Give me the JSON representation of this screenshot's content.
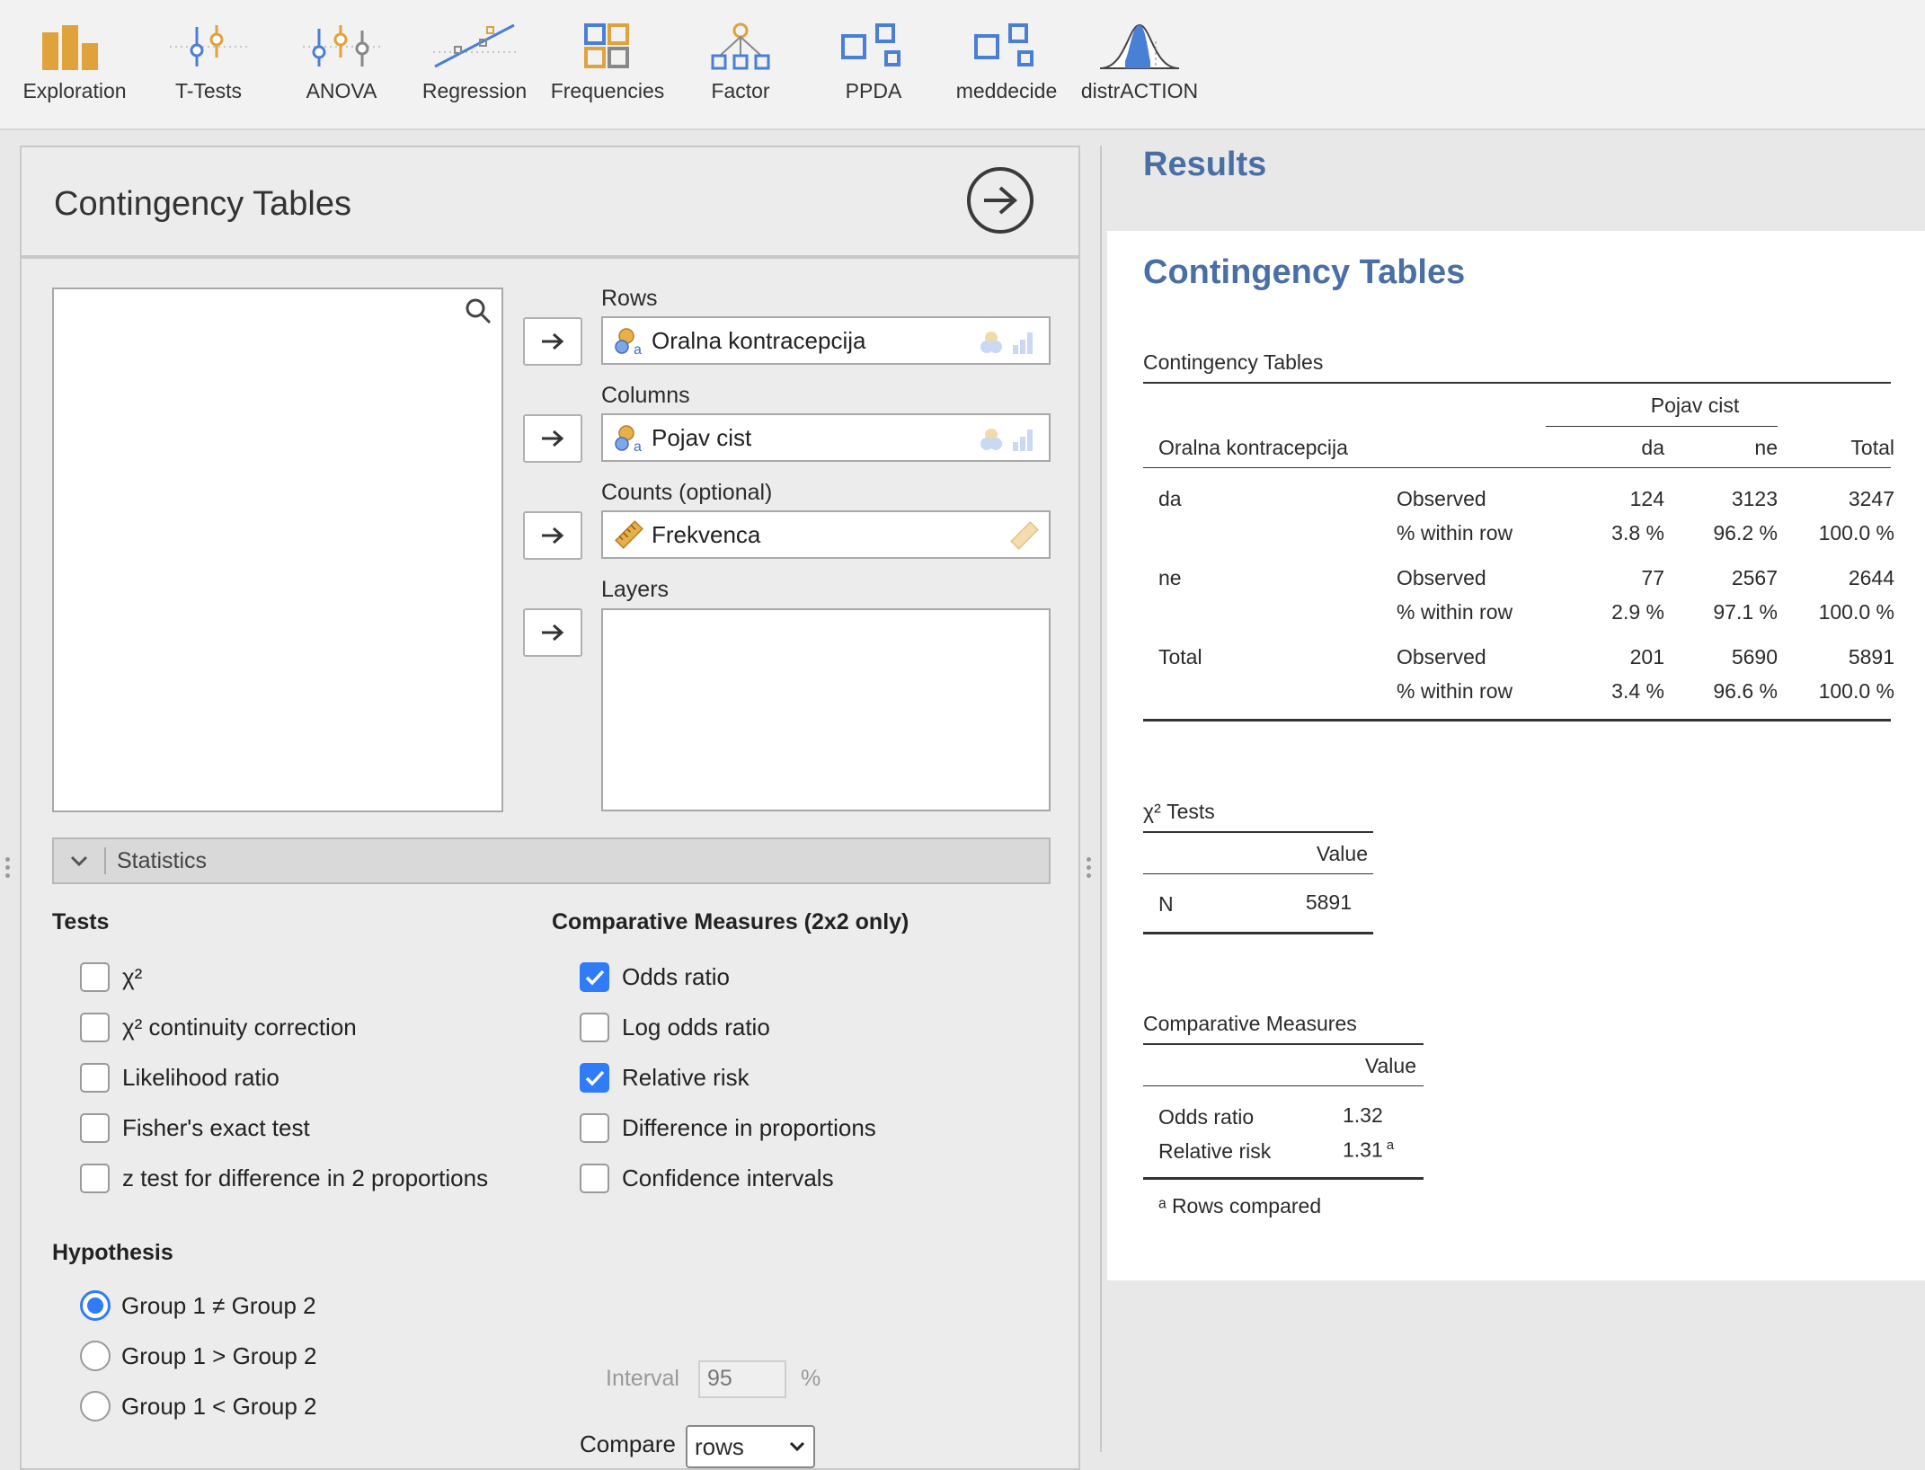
{
  "toolbar": {
    "items": [
      {
        "label": "Exploration",
        "icon": "exploration-icon"
      },
      {
        "label": "T-Tests",
        "icon": "t-tests-icon"
      },
      {
        "label": "ANOVA",
        "icon": "anova-icon"
      },
      {
        "label": "Regression",
        "icon": "regression-icon"
      },
      {
        "label": "Frequencies",
        "icon": "frequencies-icon"
      },
      {
        "label": "Factor",
        "icon": "factor-icon"
      },
      {
        "label": "PPDA",
        "icon": "ppda-icon"
      },
      {
        "label": "meddecide",
        "icon": "meddecide-icon"
      },
      {
        "label": "distrACTION",
        "icon": "distraction-icon"
      }
    ]
  },
  "analysis": {
    "title": "Contingency Tables",
    "rows": {
      "label": "Rows",
      "value": "Oralna kontracepcija"
    },
    "columns": {
      "label": "Columns",
      "value": "Pojav cist"
    },
    "counts": {
      "label": "Counts (optional)",
      "value": "Frekvenca"
    },
    "layers": {
      "label": "Layers"
    }
  },
  "statistics": {
    "section_title": "Statistics",
    "tests_heading": "Tests",
    "tests": [
      {
        "label": "χ²",
        "checked": false
      },
      {
        "label": "χ² continuity correction",
        "checked": false
      },
      {
        "label": "Likelihood ratio",
        "checked": false
      },
      {
        "label": "Fisher's exact test",
        "checked": false
      },
      {
        "label": "z test for difference in 2 proportions",
        "checked": false
      }
    ],
    "comparative_heading": "Comparative Measures (2x2 only)",
    "comparative": [
      {
        "label": "Odds ratio",
        "checked": true
      },
      {
        "label": "Log odds ratio",
        "checked": false
      },
      {
        "label": "Relative risk",
        "checked": true
      },
      {
        "label": "Difference in proportions",
        "checked": false
      },
      {
        "label": "Confidence intervals",
        "checked": false
      }
    ],
    "interval_label": "Interval",
    "interval_value": "95",
    "interval_unit": "%",
    "compare_label": "Compare",
    "compare_value": "rows",
    "hypothesis_heading": "Hypothesis",
    "hypothesis": [
      {
        "label": "Group 1 ≠ Group 2",
        "checked": true
      },
      {
        "label": "Group 1 > Group 2",
        "checked": false
      },
      {
        "label": "Group 1 < Group 2",
        "checked": false
      }
    ]
  },
  "results": {
    "title": "Results",
    "heading": "Contingency Tables",
    "table1": {
      "caption": "Contingency Tables",
      "group_header": "Pojav cist",
      "row_var": "Oralna kontracepcija",
      "col_da": "da",
      "col_ne": "ne",
      "col_total": "Total",
      "rows": [
        {
          "name": "da",
          "type1": "Observed",
          "v1": [
            "124",
            "3123",
            "3247"
          ],
          "type2": "% within row",
          "v2": [
            "3.8 %",
            "96.2 %",
            "100.0 %"
          ]
        },
        {
          "name": "ne",
          "type1": "Observed",
          "v1": [
            "77",
            "2567",
            "2644"
          ],
          "type2": "% within row",
          "v2": [
            "2.9 %",
            "97.1 %",
            "100.0 %"
          ]
        },
        {
          "name": "Total",
          "type1": "Observed",
          "v1": [
            "201",
            "5690",
            "5891"
          ],
          "type2": "% within row",
          "v2": [
            "3.4 %",
            "96.6 %",
            "100.0 %"
          ]
        }
      ]
    },
    "chi_tests": {
      "caption": "χ² Tests",
      "value_header": "Value",
      "n_label": "N",
      "n_value": "5891"
    },
    "comparative": {
      "caption": "Comparative Measures",
      "value_header": "Value",
      "odds_label": "Odds ratio",
      "odds_value": "1.32",
      "rr_label": "Relative risk",
      "rr_value": "1.31",
      "rr_sup": "a",
      "footnote": "ᵃ Rows compared"
    }
  },
  "colors": {
    "accent": "#2f7cf6",
    "results_title": "#4a6fa5",
    "icon_orange": "#e0a23a",
    "icon_blue": "#4a7fd6"
  }
}
